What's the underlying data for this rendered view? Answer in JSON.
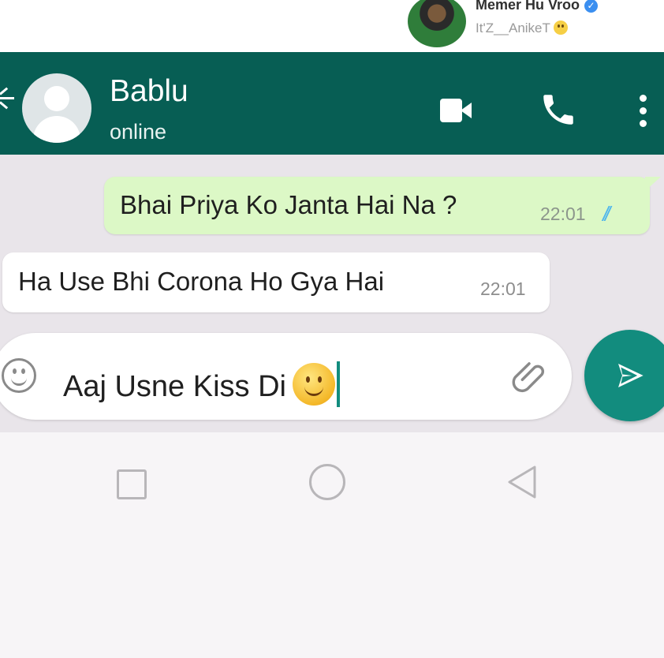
{
  "watermark": {
    "name": "Memer Hu Vroo",
    "handle": "It'Z__AnikeT"
  },
  "header": {
    "contact_name": "Bablu",
    "status": "online"
  },
  "messages": [
    {
      "direction": "outgoing",
      "text": "Bhai Priya Ko Janta Hai Na ?",
      "time": "22:01",
      "ticks": "//"
    },
    {
      "direction": "incoming",
      "text": "Ha Use Bhi Corona Ho Gya Hai",
      "time": "22:01"
    }
  ],
  "composer": {
    "text": "Aaj Usne Kiss Di"
  },
  "colors": {
    "header": "#075e54",
    "outgoing_bubble": "#dcf8c6",
    "send_button": "#128c7e",
    "read_ticks": "#4fb6ec"
  },
  "icons": [
    "back-arrow-icon",
    "video-call-icon",
    "phone-icon",
    "more-options-icon",
    "emoji-icon",
    "attach-icon",
    "send-icon",
    "nav-recents-icon",
    "nav-home-icon",
    "nav-back-icon"
  ]
}
